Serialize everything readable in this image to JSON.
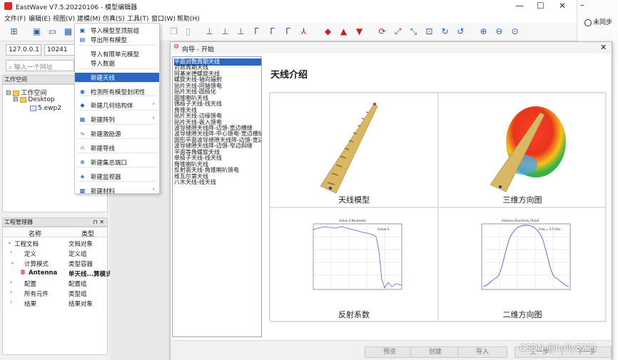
{
  "window": {
    "title": "EastWave V7.5.20220106 - 模型编辑器"
  },
  "menu": [
    "文件(F)",
    "编辑(E)",
    "视图(V)",
    "建模(M)",
    "仿真(S)",
    "工具(T)",
    "窗口(W)",
    "帮助(H)"
  ],
  "right_strip": {
    "text1": "未同步",
    "text2": "同步"
  },
  "address": {
    "ip": "127.0.0.1",
    "port": "10241",
    "url_placeholder": "输入一个网址"
  },
  "workspace": {
    "title": "工作空间",
    "root": "工作空间",
    "folder": "Desktop",
    "file": "5.ewp2"
  },
  "project_manager": {
    "title": "工程管理器",
    "col_name": "名称",
    "col_type": "类型",
    "rows": [
      {
        "name": "工程文档",
        "type": "文档对象"
      },
      {
        "name": "定义",
        "type": "定义组"
      },
      {
        "name": "计算模式",
        "type": "类型容器"
      },
      {
        "name": "Antenna",
        "type": "单天线...算模式"
      },
      {
        "name": "配置",
        "type": "配置组"
      },
      {
        "name": "所有元件",
        "type": "类型组"
      },
      {
        "name": "结果",
        "type": "结果对象"
      }
    ]
  },
  "dropdown": [
    {
      "label": "导入模型至顶层组",
      "icon": "import-icon"
    },
    {
      "label": "导出所有模型",
      "icon": "export-icon"
    },
    {
      "label": "导入有限单元模型",
      "icon": ""
    },
    {
      "label": "导入数据",
      "icon": ""
    },
    {
      "label": "新建天线",
      "icon": "",
      "highlight": true
    },
    {
      "label": "检测所有模型封闭性",
      "icon": "check-icon"
    },
    {
      "label": "新建几何结构体",
      "icon": "geometry-icon",
      "submenu": true
    },
    {
      "label": "新建阵列",
      "icon": "array-icon",
      "submenu": true
    },
    {
      "label": "新建激励源",
      "icon": "source-icon"
    },
    {
      "label": "新建导线",
      "icon": "wire-icon"
    },
    {
      "label": "新建集总端口",
      "icon": "port-icon"
    },
    {
      "label": "新建监视器",
      "icon": "monitor-icon"
    },
    {
      "label": "新建材料",
      "icon": "material-icon",
      "submenu": true
    }
  ],
  "wizard": {
    "title": "向导 - 开始",
    "heading": "天线介绍",
    "antenna_list": [
      "平面对数周期天线",
      "对数周期天线",
      "阿基米德螺旋天线",
      "螺旋天线-轴向辐射",
      "贴片天线-同轴馈电",
      "贴片天线-圆极化",
      "圆锥喇叭天线",
      "偶极子天线-线天线",
      "角锥天线",
      "贴片天线-边缘馈电",
      "贴片天线-嵌入馈电",
      "波导缝隙天线阵-边馈-宽边横缝",
      "波导缝隙天线阵-中心馈电-宽边横缝",
      "圆形平面波导缝隙天线阵-边馈-宽边横缝",
      "波导缝隙天线阵-边馈-窄边斜缝",
      "平面等角螺旋天线",
      "单极子天线-线天线",
      "角锥喇叭天线",
      "反射面天线-角锥喇叭馈电",
      "维瓦尔第天线",
      "八木天线-线天线"
    ],
    "captions": [
      "天线模型",
      "三维方向图",
      "反射系数",
      "二维方向图"
    ],
    "buttons": [
      "预览",
      "创建",
      "导入",
      "上一步",
      "下一步"
    ],
    "plot_s11_title": "Active-S Parameter",
    "plot_s11_legend": "Active-S",
    "plot_dir_title": "Antenna Directivity (Total)",
    "plot_dir_legend": "Freq = 3.5 GHz"
  },
  "watermark": "CSDN @holly5221"
}
